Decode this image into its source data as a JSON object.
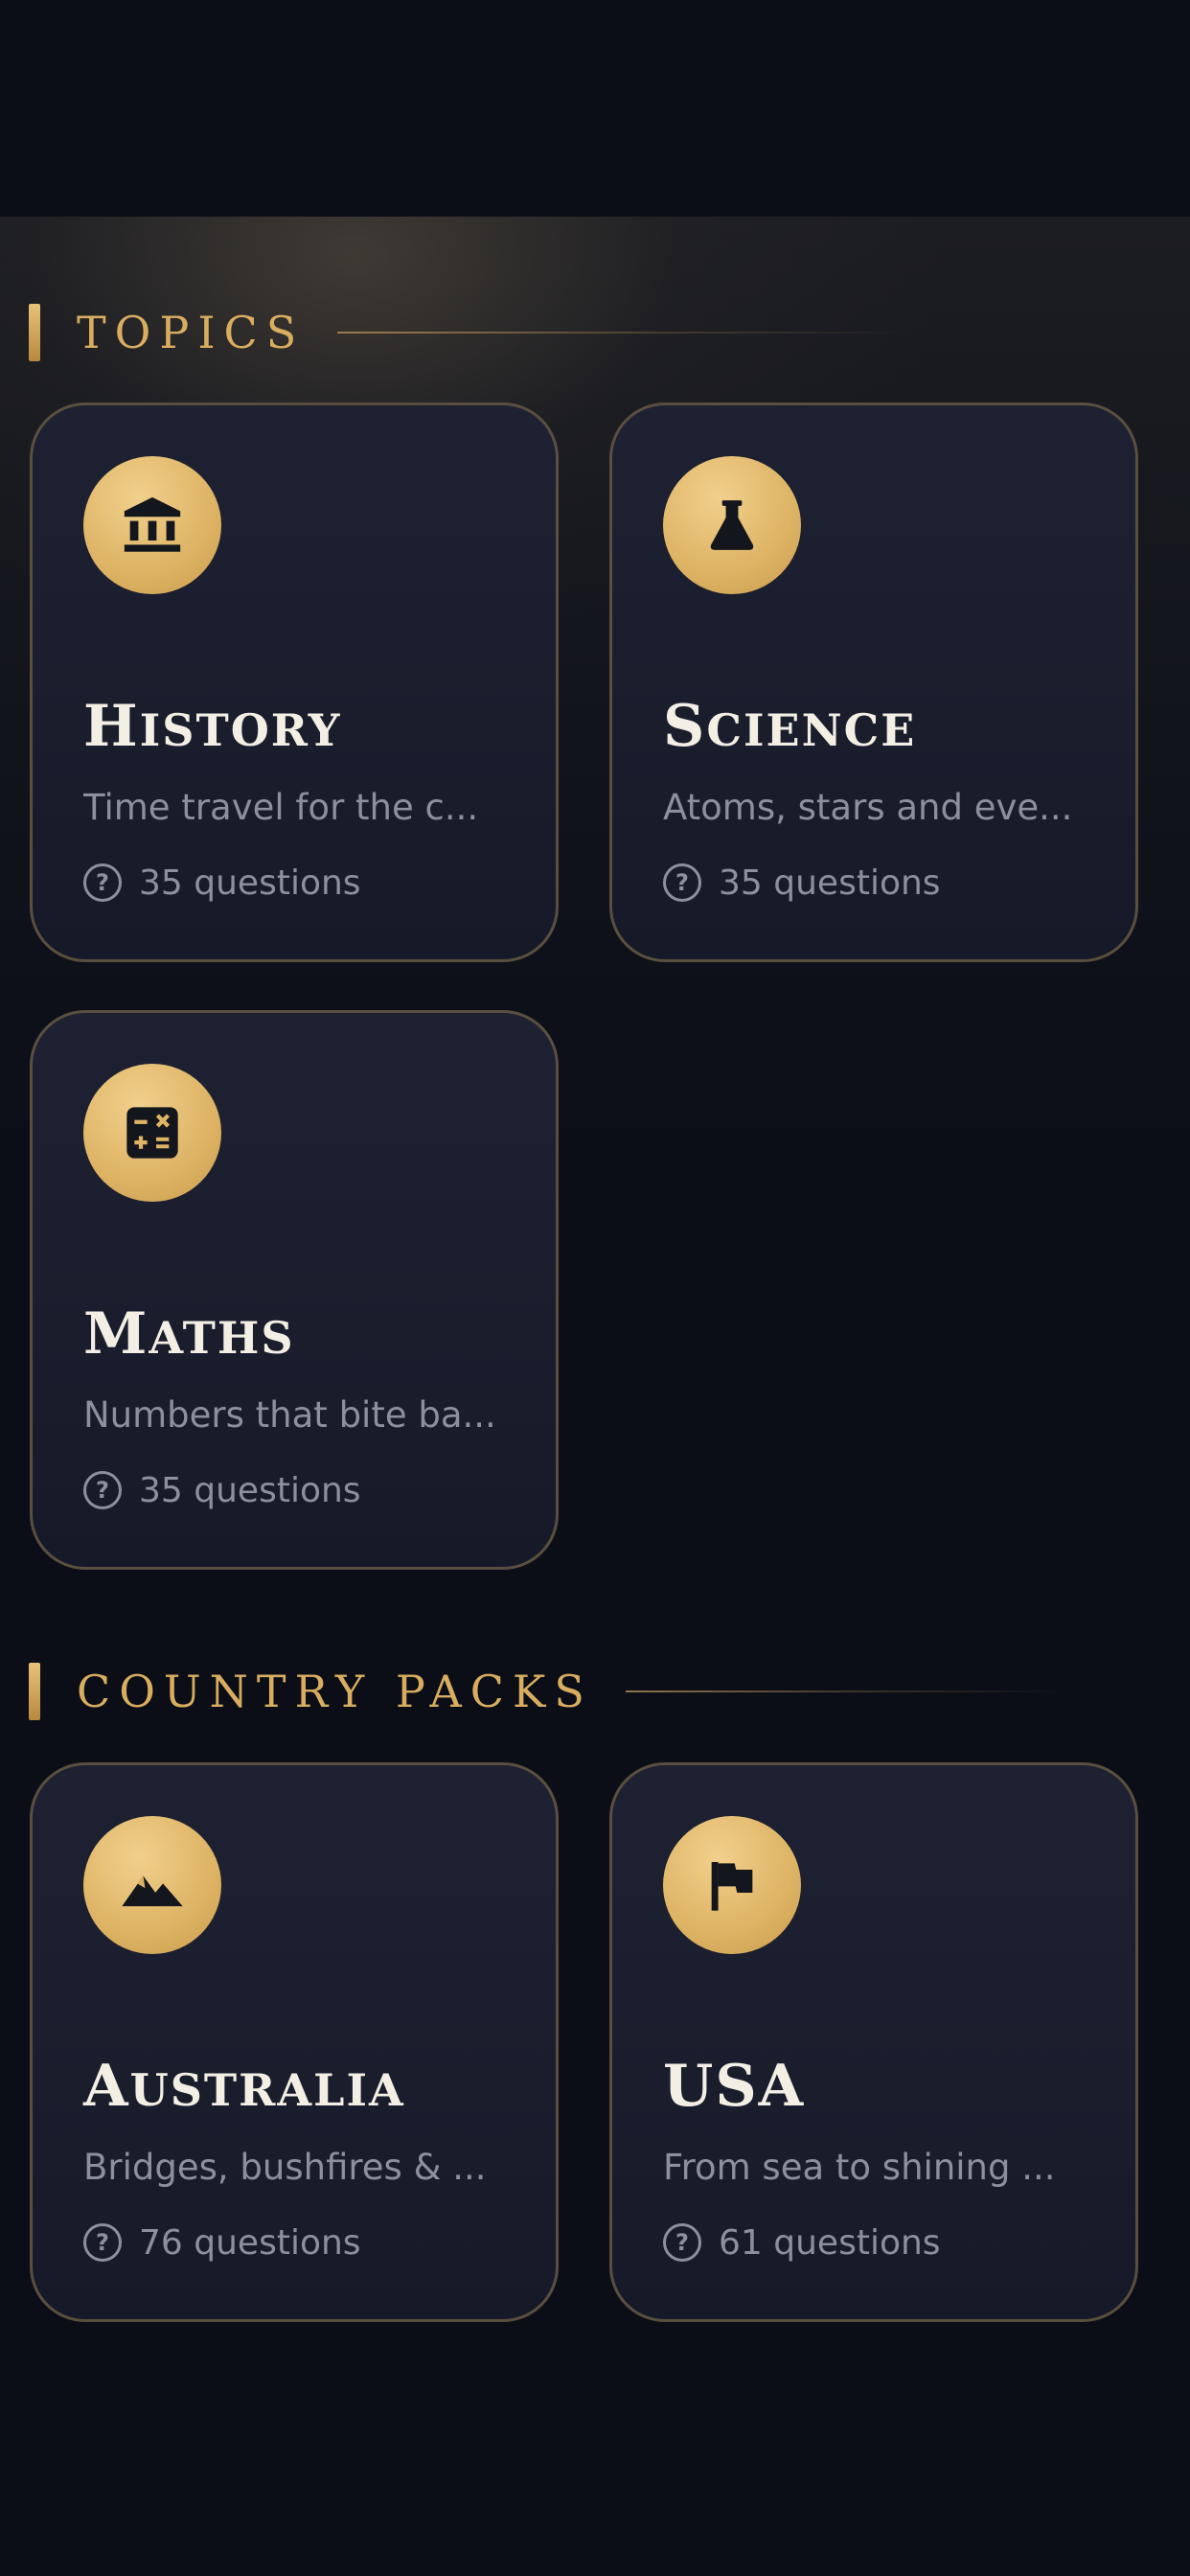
{
  "sections": [
    {
      "title": "TOPICS",
      "cards": [
        {
          "title": "History",
          "icon": "bank-icon",
          "description": "Time travel for the c...",
          "count": "35 questions"
        },
        {
          "title": "Science",
          "icon": "flask-icon",
          "description": "Atoms, stars and eve...",
          "count": "35 questions"
        },
        {
          "title": "Maths",
          "icon": "calculator-icon",
          "description": "Numbers that bite ba...",
          "count": "35 questions"
        }
      ]
    },
    {
      "title": "COUNTRY PACKS",
      "cards": [
        {
          "title": "Australia",
          "icon": "mountain-icon",
          "description": "Bridges, bushfires & ...",
          "count": "76 questions"
        },
        {
          "title": "USA",
          "icon": "flag-icon",
          "description": "From sea to shining ...",
          "count": "61 questions"
        }
      ]
    }
  ],
  "colors": {
    "background": "#0b0e17",
    "accent_gold": "#d9ad5f",
    "card_border": "#5a4f3f",
    "card_title": "#f4efe4",
    "muted_text": "#8c909e"
  }
}
